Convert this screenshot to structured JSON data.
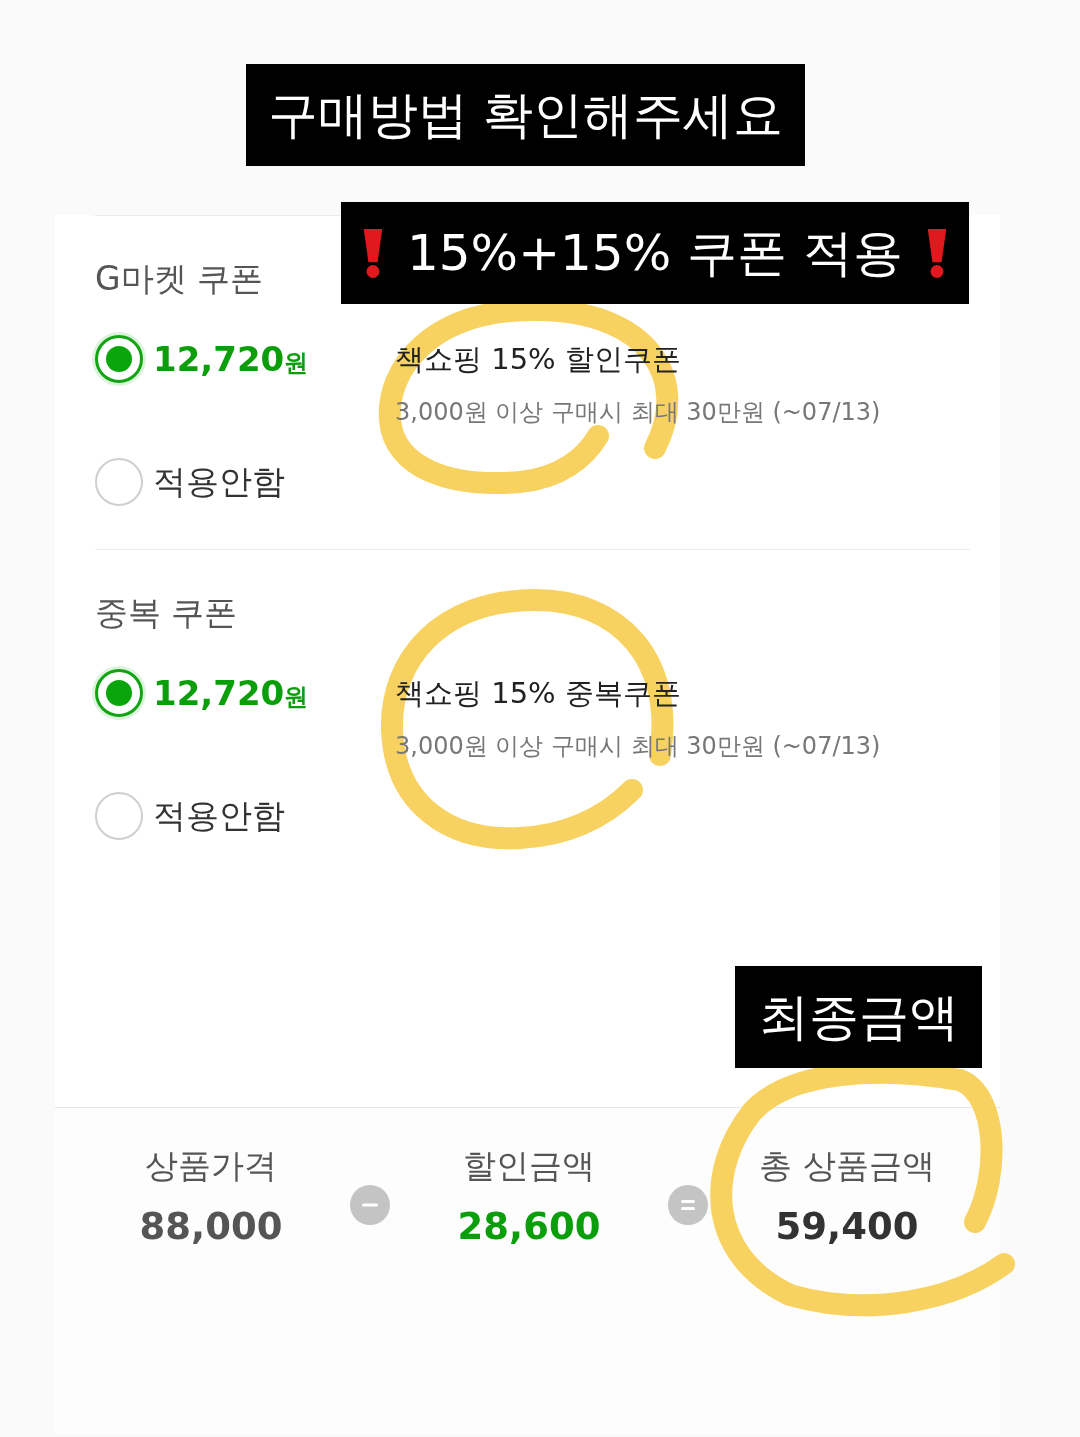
{
  "title_banner": "구매방법 확인해주세요",
  "coupon_banner": "15%+15% 쿠폰 적용",
  "coupon_groups": [
    {
      "title": "G마켓 쿠폰",
      "options": [
        {
          "kind": "coupon",
          "amount": "12,720",
          "unit": "원",
          "name": "책쇼핑 15% 할인쿠폰",
          "condition": "3,000원 이상 구매시 최대 30만원 (~07/13)",
          "selected": true
        },
        {
          "kind": "none",
          "label": "적용안함",
          "selected": false
        }
      ]
    },
    {
      "title": "중복 쿠폰",
      "options": [
        {
          "kind": "coupon",
          "amount": "12,720",
          "unit": "원",
          "name": "책쇼핑 15% 중복쿠폰",
          "condition": "3,000원 이상 구매시 최대 30만원 (~07/13)",
          "selected": true
        },
        {
          "kind": "none",
          "label": "적용안함",
          "selected": false
        }
      ]
    }
  ],
  "total_banner": "최종금액",
  "summary": [
    {
      "kind": "price",
      "label": "상품가격",
      "value": "88,000"
    },
    {
      "kind": "minus"
    },
    {
      "kind": "discount",
      "label": "할인금액",
      "value": "28,600"
    },
    {
      "kind": "equals"
    },
    {
      "kind": "total",
      "label": "총 상품금액",
      "value": "59,400"
    }
  ]
}
